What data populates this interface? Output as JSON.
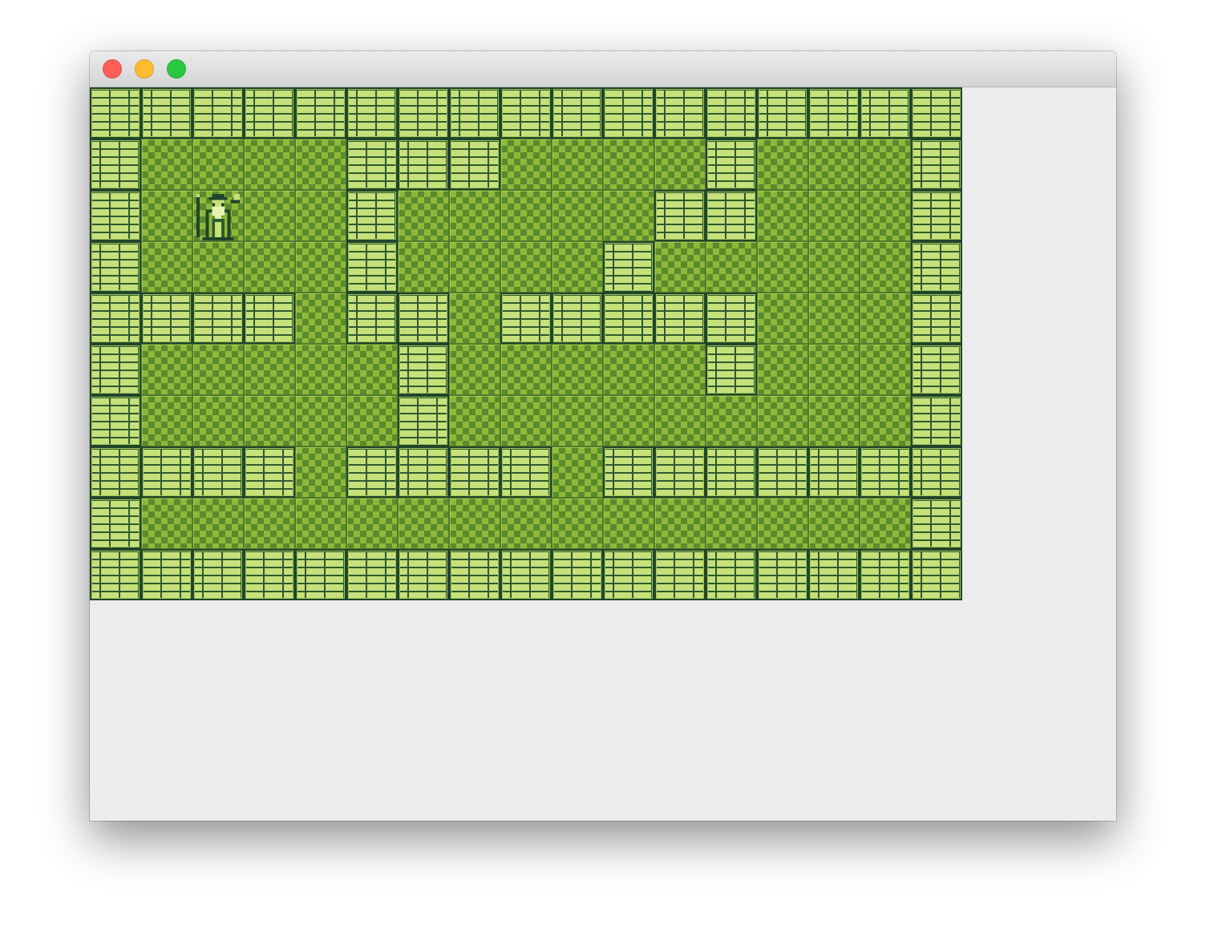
{
  "window": {
    "title": "",
    "buttons": {
      "close_color": "#fe5f57",
      "minimize_color": "#febc2e",
      "zoom_color": "#28c840"
    }
  },
  "palette": {
    "wall_light": "#c6e07a",
    "wall_dark": "#2f5a2e",
    "floor_light": "#8fb83a",
    "floor_dark": "#5a8a2c",
    "background": "#ececec"
  },
  "map": {
    "columns": 17,
    "rows": 10,
    "legend": {
      "#": "wall",
      ".": "floor",
      "@": "wizard"
    },
    "grid": [
      "#################",
      "#....###....#...#",
      "#.@..#.....##...#",
      "#....#....#.....#",
      "####.##.#####...#",
      "#.....#.....#...#",
      "#.....#.........#",
      "####.####.#######",
      "#...............#",
      "#################"
    ]
  },
  "player": {
    "sprite": "wizard-icon",
    "row": 2,
    "col": 2
  }
}
